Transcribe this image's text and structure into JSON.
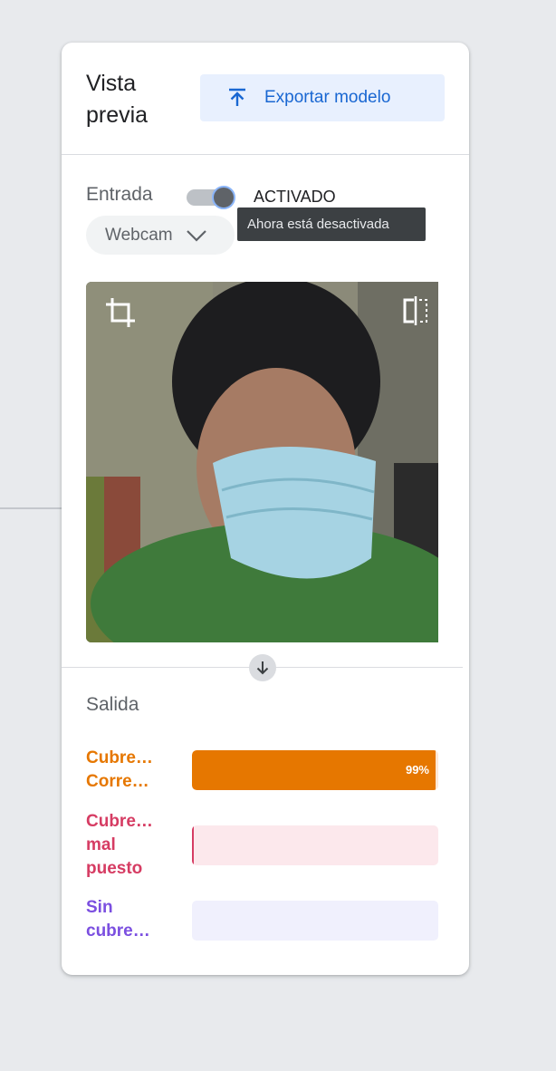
{
  "panel": {
    "title": "Vista\nprevia",
    "export_label": "Exportar modelo"
  },
  "input": {
    "label": "Entrada",
    "toggle_state": "ACTIVADO",
    "tooltip": "Ahora está desactivada",
    "source": "Webcam"
  },
  "output": {
    "label": "Salida",
    "classes": [
      {
        "label": "Cubre…\nCorre…",
        "confidence": 0.99,
        "percent_text": "99%",
        "color": "#e67700",
        "track": "#fde8d6"
      },
      {
        "label": "Cubre…\nmal\npuesto",
        "confidence": 0.0,
        "percent_text": "",
        "color": "#d63c63",
        "track": "#fce8ec"
      },
      {
        "label": "Sin\ncubre…",
        "confidence": 0.0,
        "percent_text": "",
        "color": "#7b4fe0",
        "track": "#f0f0fd"
      }
    ]
  },
  "colors": {
    "accent": "#1967d2",
    "background": "#e8eaed"
  },
  "icons": [
    "export-upload-icon",
    "chevron-down-icon",
    "crop-icon",
    "flip-icon",
    "arrow-down-icon"
  ]
}
